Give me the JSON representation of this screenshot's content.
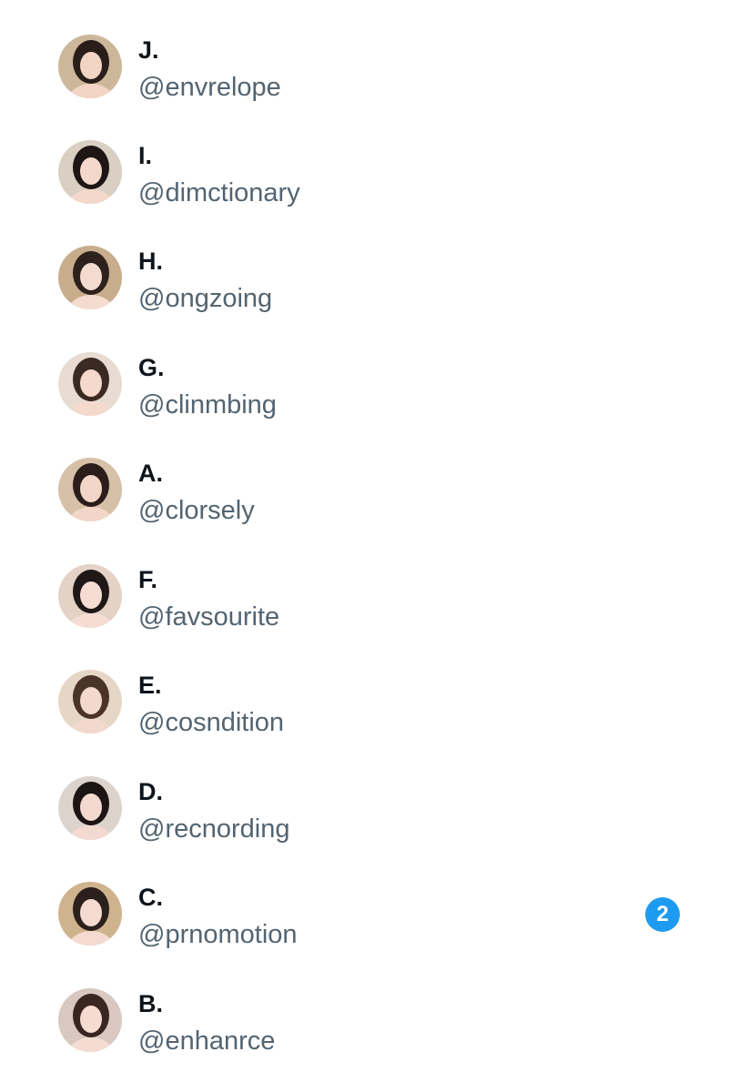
{
  "conversations": [
    {
      "name": "J.",
      "handle": "@envrelope",
      "avatar": {
        "skin": "#f2d4c4",
        "hair": "#2a1e1a",
        "bg": "#cdb79a"
      }
    },
    {
      "name": "I.",
      "handle": "@dimctionary",
      "avatar": {
        "skin": "#f4d8cc",
        "hair": "#1e1614",
        "bg": "#d9cfc2"
      }
    },
    {
      "name": "H.",
      "handle": "@ongzoing",
      "avatar": {
        "skin": "#f3dbcf",
        "hair": "#2c211c",
        "bg": "#c8ad8c"
      }
    },
    {
      "name": "G.",
      "handle": "@clinmbing",
      "avatar": {
        "skin": "#f5d9cc",
        "hair": "#3a2a22",
        "bg": "#e8dcd2"
      }
    },
    {
      "name": "A.",
      "handle": "@clorsely",
      "avatar": {
        "skin": "#f4d6c8",
        "hair": "#2a1d1a",
        "bg": "#d6c1a8"
      }
    },
    {
      "name": "F.",
      "handle": "@favsourite",
      "avatar": {
        "skin": "#f5ddd3",
        "hair": "#1f1816",
        "bg": "#e4d2c6"
      }
    },
    {
      "name": "E.",
      "handle": "@cosndition",
      "avatar": {
        "skin": "#f2d8cd",
        "hair": "#4a3328",
        "bg": "#e6d6c6"
      }
    },
    {
      "name": "D.",
      "handle": "@recnording",
      "avatar": {
        "skin": "#f3d9cf",
        "hair": "#1c1513",
        "bg": "#dcd4cc"
      }
    },
    {
      "name": "C.",
      "handle": "@prnomotion",
      "avatar": {
        "skin": "#f4dad0",
        "hair": "#2b201b",
        "bg": "#cfb38f"
      },
      "unread": "2"
    },
    {
      "name": "B.",
      "handle": "@enhanrce",
      "avatar": {
        "skin": "#f5dcd2",
        "hair": "#3a2620",
        "bg": "#d8c8c0"
      }
    }
  ],
  "colors": {
    "name_text": "#0f1419",
    "handle_text": "#536471",
    "badge": "#1d9bf0"
  }
}
